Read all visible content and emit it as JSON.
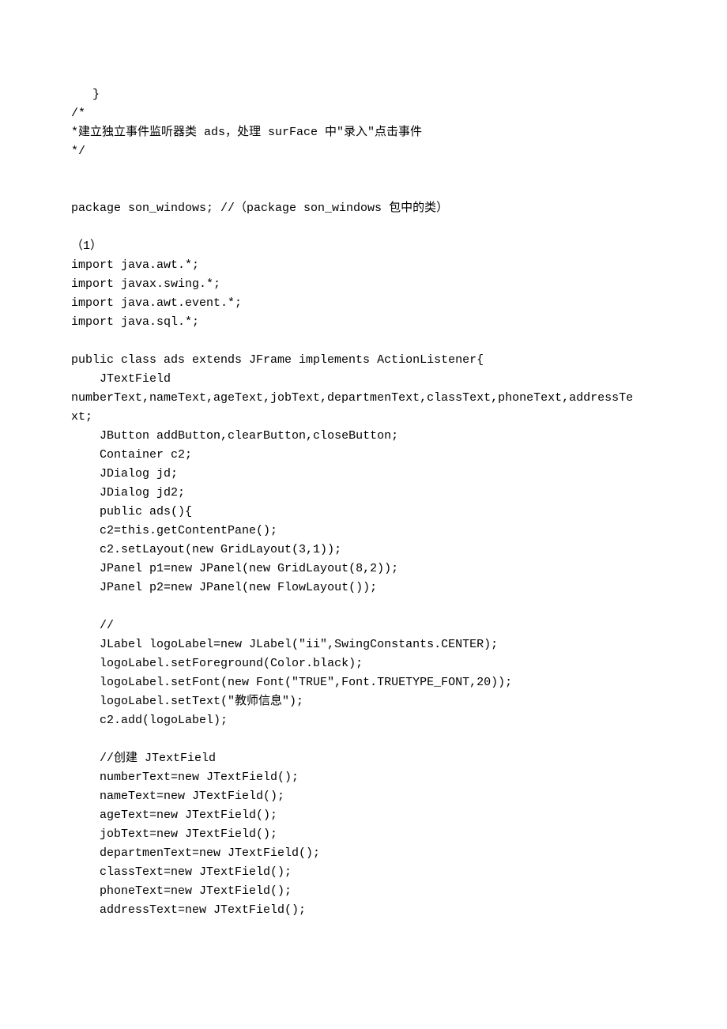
{
  "lines": [
    "   }",
    "/*",
    "*建立独立事件监听器类 ads，处理 surFace 中\"录入\"点击事件",
    "*/",
    "",
    "",
    "package son_windows; //（package son_windows 包中的类）",
    "",
    "（1）",
    "import java.awt.*;",
    "import javax.swing.*;",
    "import java.awt.event.*;",
    "import java.sql.*;",
    "",
    "public class ads extends JFrame implements ActionListener{",
    "    JTextField",
    "numberText,nameText,ageText,jobText,departmenText,classText,phoneText,addressTe",
    "xt;",
    "    JButton addButton,clearButton,closeButton;",
    "    Container c2;",
    "    JDialog jd;",
    "    JDialog jd2;",
    "    public ads(){",
    "    c2=this.getContentPane();",
    "    c2.setLayout(new GridLayout(3,1));",
    "    JPanel p1=new JPanel(new GridLayout(8,2));",
    "    JPanel p2=new JPanel(new FlowLayout());",
    "",
    "    //",
    "    JLabel logoLabel=new JLabel(\"ii\",SwingConstants.CENTER);",
    "    logoLabel.setForeground(Color.black);",
    "    logoLabel.setFont(new Font(\"TRUE\",Font.TRUETYPE_FONT,20));",
    "    logoLabel.setText(\"教师信息\");",
    "    c2.add(logoLabel);",
    "",
    "    //创建 JTextField",
    "    numberText=new JTextField();",
    "    nameText=new JTextField();",
    "    ageText=new JTextField();",
    "    jobText=new JTextField();",
    "    departmenText=new JTextField();",
    "    classText=new JTextField();",
    "    phoneText=new JTextField();",
    "    addressText=new JTextField();"
  ]
}
